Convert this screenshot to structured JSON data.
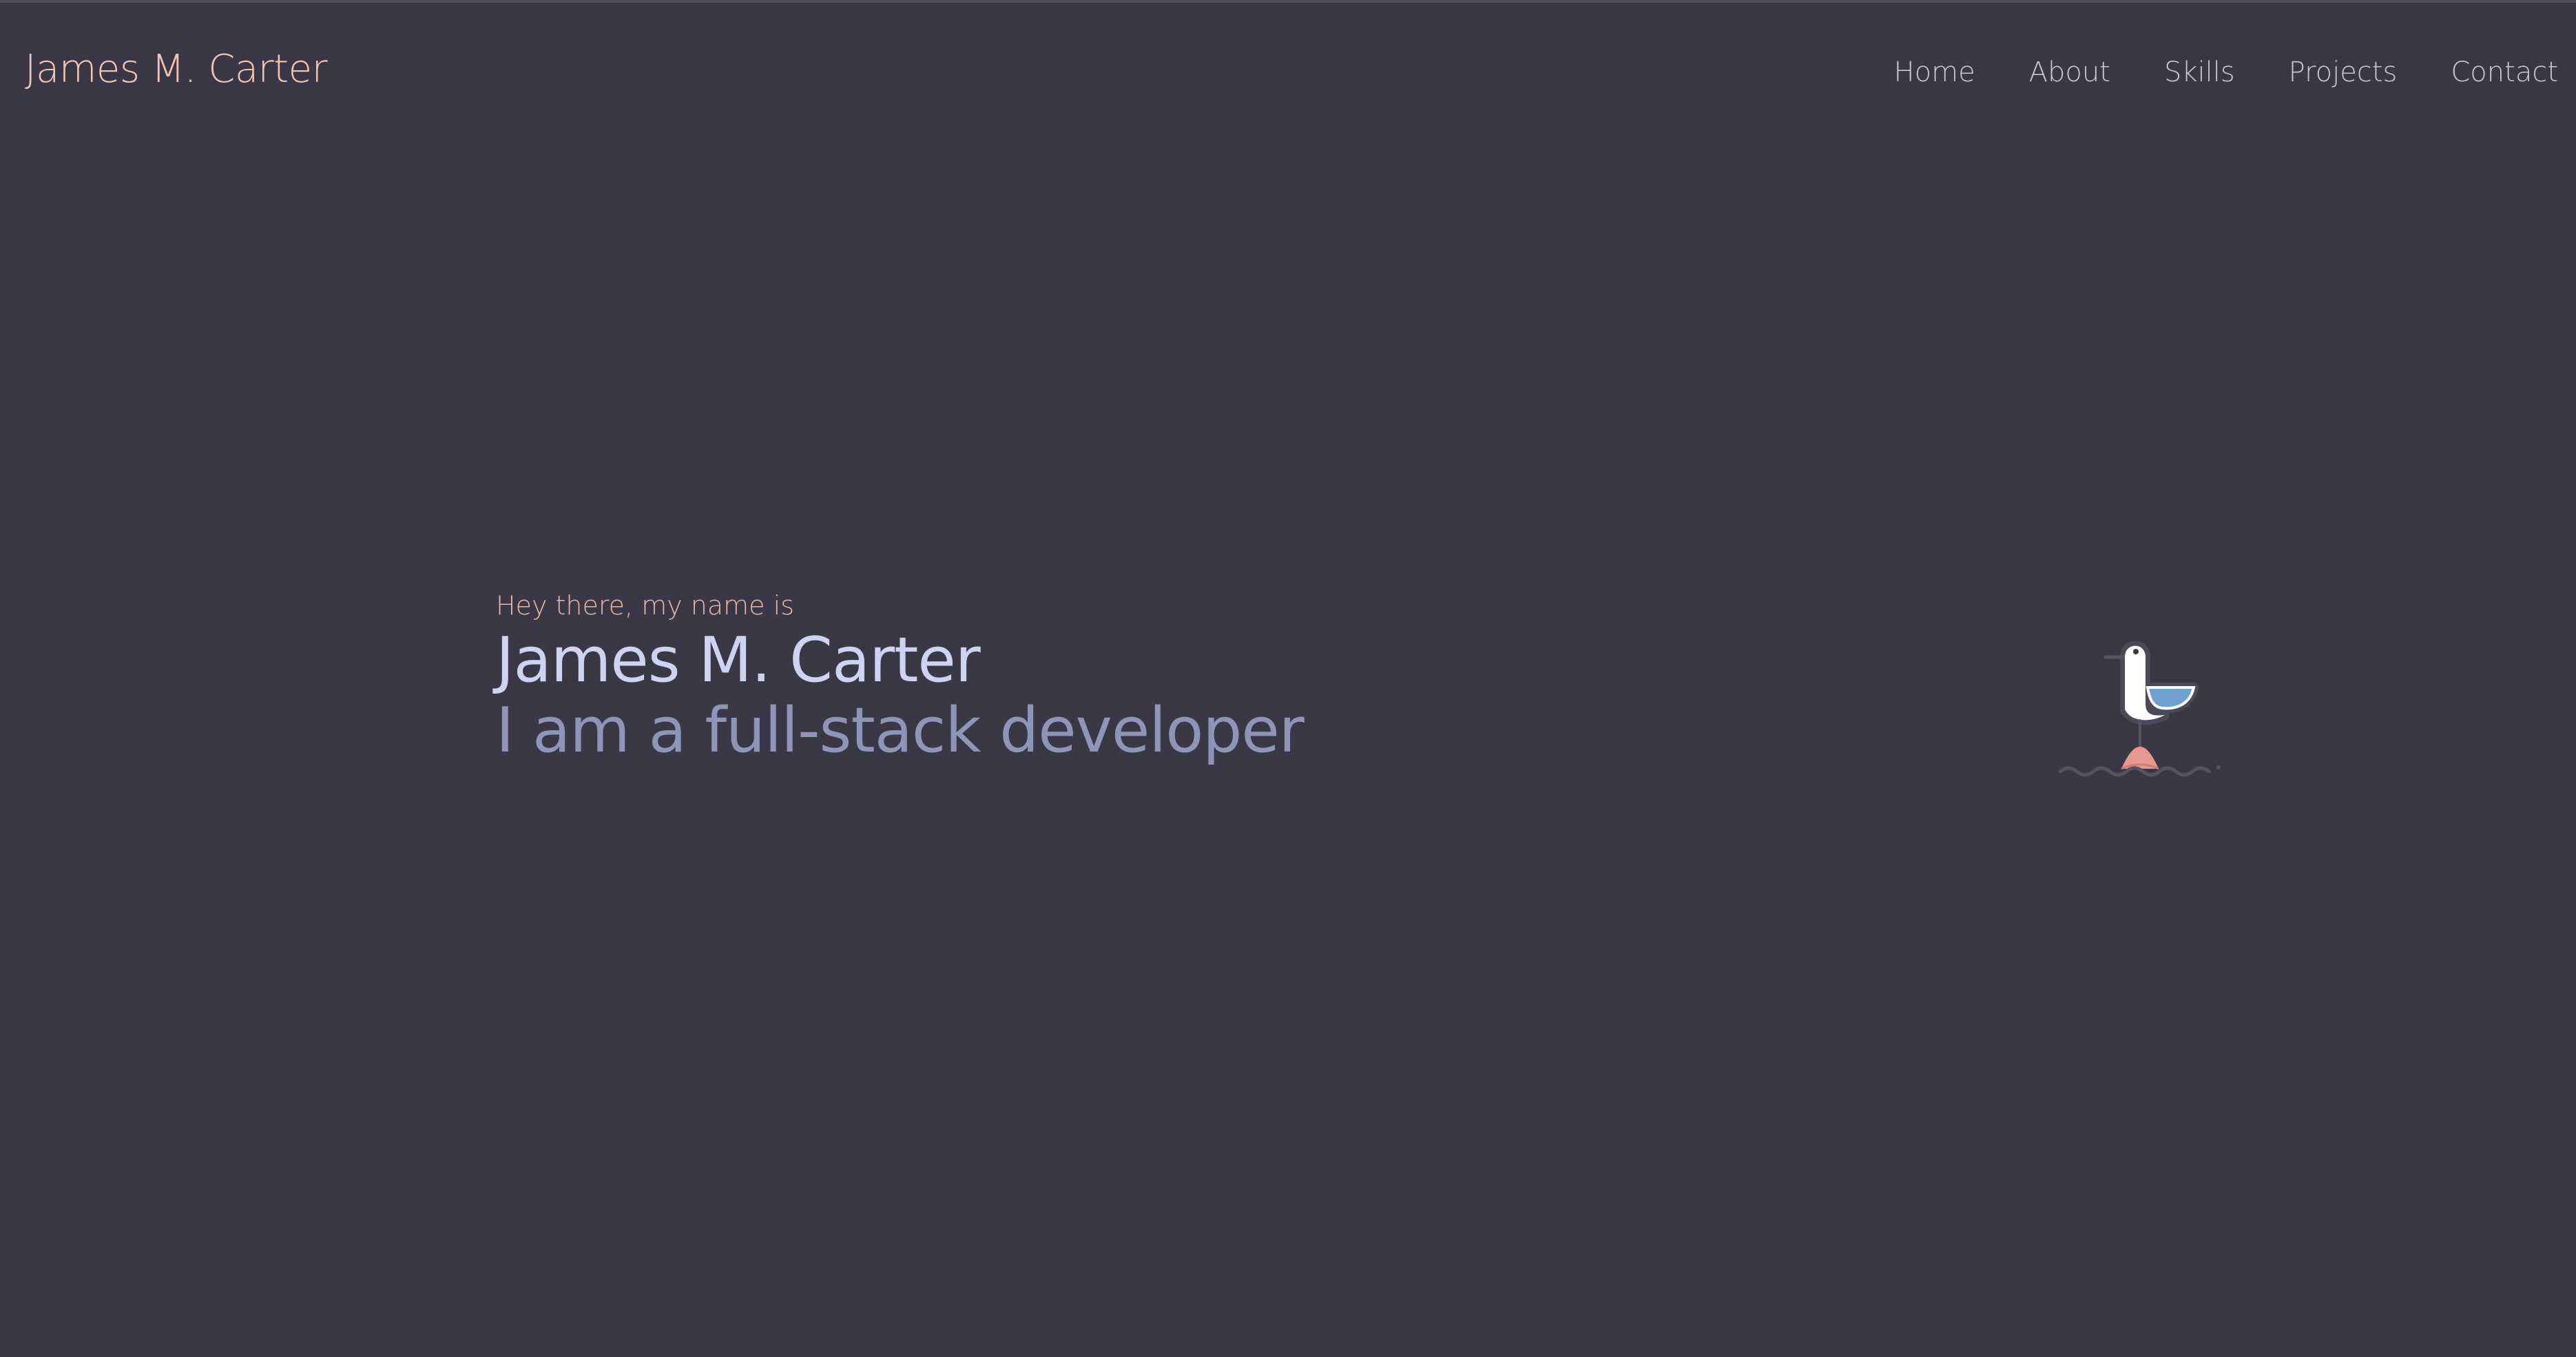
{
  "header": {
    "brand": "James M. Carter",
    "nav": [
      {
        "label": "Home"
      },
      {
        "label": "About"
      },
      {
        "label": "Skills"
      },
      {
        "label": "Projects"
      },
      {
        "label": "Contact"
      }
    ]
  },
  "hero": {
    "greeting": "Hey there, my name is",
    "name": "James M. Carter",
    "role": "I am a full-stack developer",
    "illustration": "seagull-on-buoy-icon"
  },
  "colors": {
    "background": "#3a3847",
    "brand": "#f0c6b1",
    "nav_text": "#c9c6d6",
    "greeting": "#e8b8a0",
    "name": "#cdd3f0",
    "role": "#8f95b6",
    "bird_wing": "#6ea0d0",
    "buoy": "#e8988e"
  }
}
